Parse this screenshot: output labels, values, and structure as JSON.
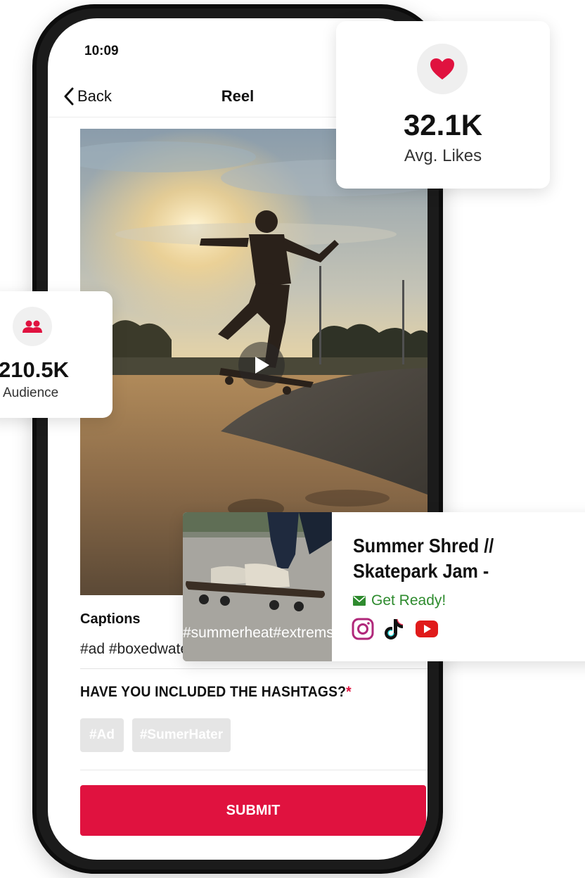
{
  "status": {
    "time": "10:09"
  },
  "nav": {
    "back_label": "Back",
    "title": "Reel"
  },
  "captions": {
    "title": "Captions",
    "text_visible": "#ad #boxedwater",
    "overlay_text": "#summerheat#extremsp"
  },
  "hashtag_question": {
    "text": "HAVE YOU INCLUDED THE HASHTAGS?",
    "required_mark": "*"
  },
  "hashtag_chips": [
    "#Ad",
    "#SumerHater"
  ],
  "submit_label": "SUBMIT",
  "likes_card": {
    "value": "32.1K",
    "label": "Avg. Likes"
  },
  "audience_card": {
    "value": "210.5K",
    "label": "Audience"
  },
  "post_card": {
    "title_line1": "Summer Shred //",
    "title_line2": "Skatepark Jam -",
    "cta": "Get Ready!",
    "social_icons": [
      "instagram-icon",
      "tiktok-icon",
      "youtube-icon"
    ]
  },
  "colors": {
    "accent": "#e0123f",
    "cta_green": "#2e8b2e",
    "chip_bg": "#e5e5e5"
  }
}
